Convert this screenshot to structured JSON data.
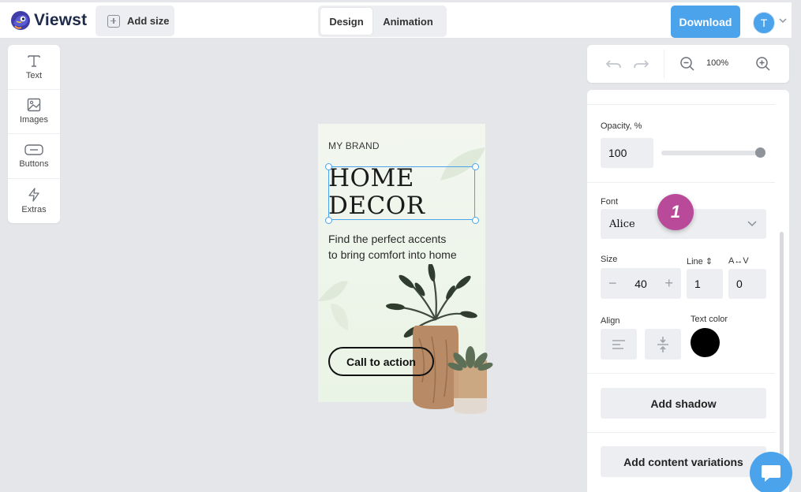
{
  "header": {
    "logo_text": "Viewst",
    "add_size_label": "Add size",
    "tabs": [
      {
        "label": "Design",
        "active": true
      },
      {
        "label": "Animation",
        "active": false
      }
    ],
    "download_label": "Download",
    "avatar_initial": "T"
  },
  "toolbox": {
    "items": [
      {
        "label": "Text",
        "icon": "text-icon"
      },
      {
        "label": "Images",
        "icon": "image-icon"
      },
      {
        "label": "Buttons",
        "icon": "button-icon"
      },
      {
        "label": "Extras",
        "icon": "lightning-icon"
      }
    ]
  },
  "canvas": {
    "brand": "MY BRAND",
    "headline_line1": "HOME",
    "headline_line2": "DECOR",
    "subtext_line1": "Find the perfect accents",
    "subtext_line2": "to bring comfort into home",
    "cta": "Call to action"
  },
  "zoombar": {
    "zoom": "100%"
  },
  "panel": {
    "opacity_label": "Opacity, %",
    "opacity_value": "100",
    "opacity_fraction": 1.0,
    "font_label": "Font",
    "font_value": "Alice",
    "size_label": "Size",
    "size_value": "40",
    "line_label": "Line ⇕",
    "line_value": "1",
    "spacing_label": "A↔V",
    "spacing_value": "0",
    "align_label": "Align",
    "text_color_label": "Text color",
    "text_color": "#000000",
    "add_shadow_label": "Add shadow",
    "add_variations_label": "Add content variations"
  },
  "annotation": {
    "badge": "1"
  },
  "colors": {
    "accent": "#4ba3ec",
    "badge": "#b94a9a",
    "canvas_bg": "#e4e6e9"
  }
}
